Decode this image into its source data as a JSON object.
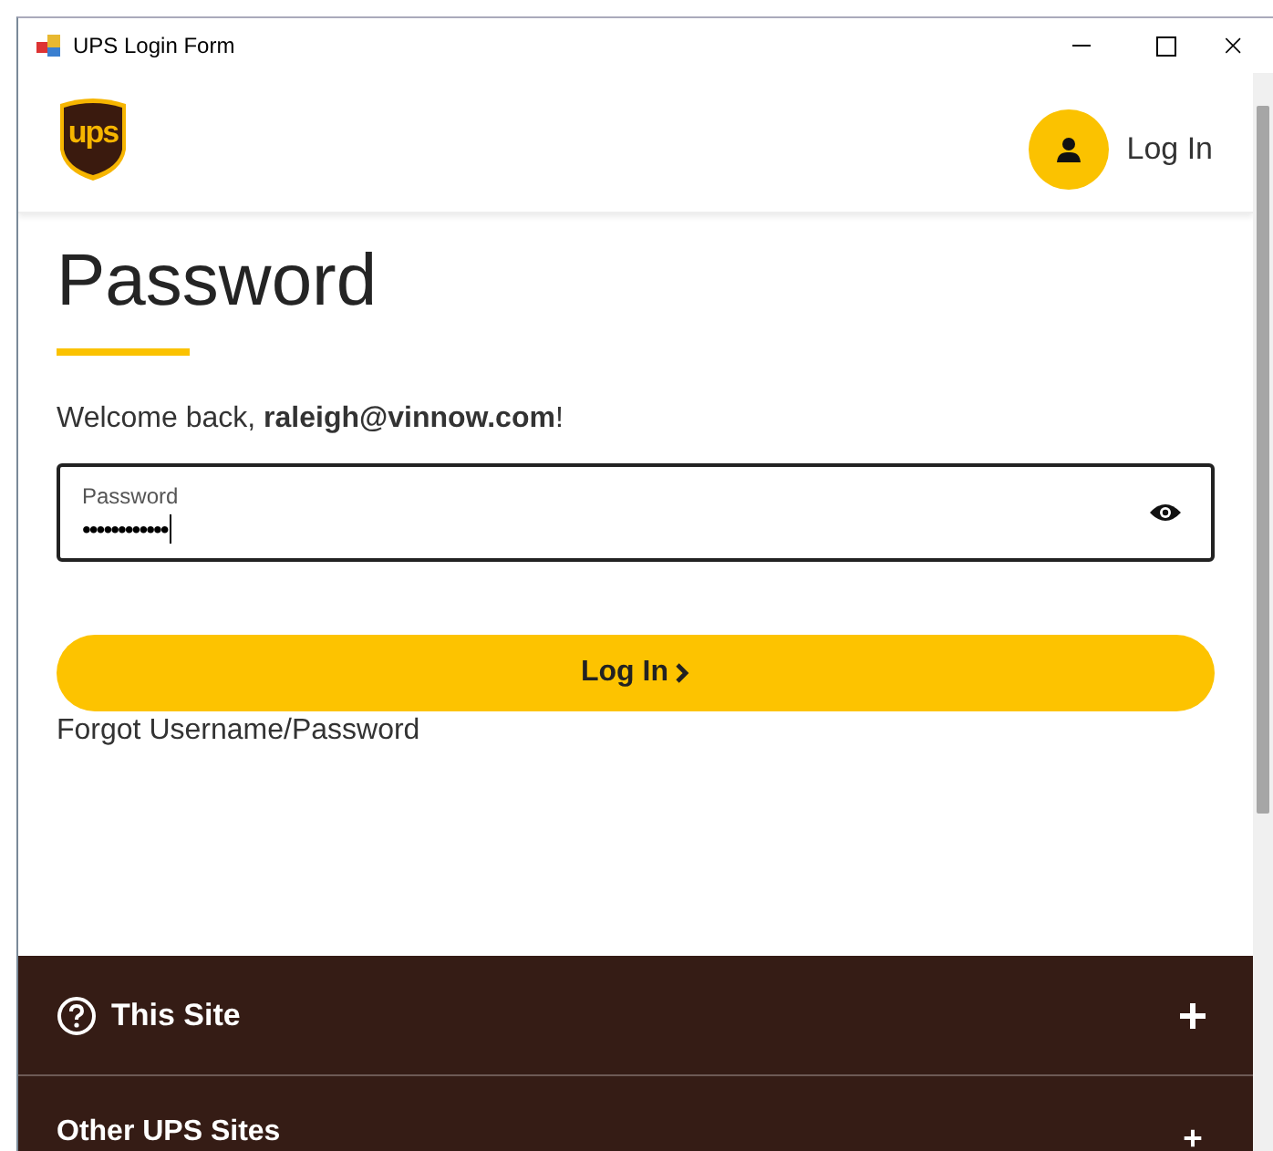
{
  "window": {
    "title": "UPS Login Form"
  },
  "header": {
    "logo_text": "ups",
    "login_link": "Log In"
  },
  "form": {
    "heading": "Password",
    "welcome": "Welcome back, **raleigh@vinnow.com**!",
    "password_field": {
      "label": "Password",
      "value": "••••••••••••"
    },
    "submit": "Log In",
    "forgot_link": "Forgot Username/Password"
  },
  "footer_sections": [
    {
      "title": "This Site",
      "kind": "help",
      "expanded": false
    },
    {
      "title": "Other UPS Sites",
      "kind": "plain",
      "expanded": false
    }
  ]
}
